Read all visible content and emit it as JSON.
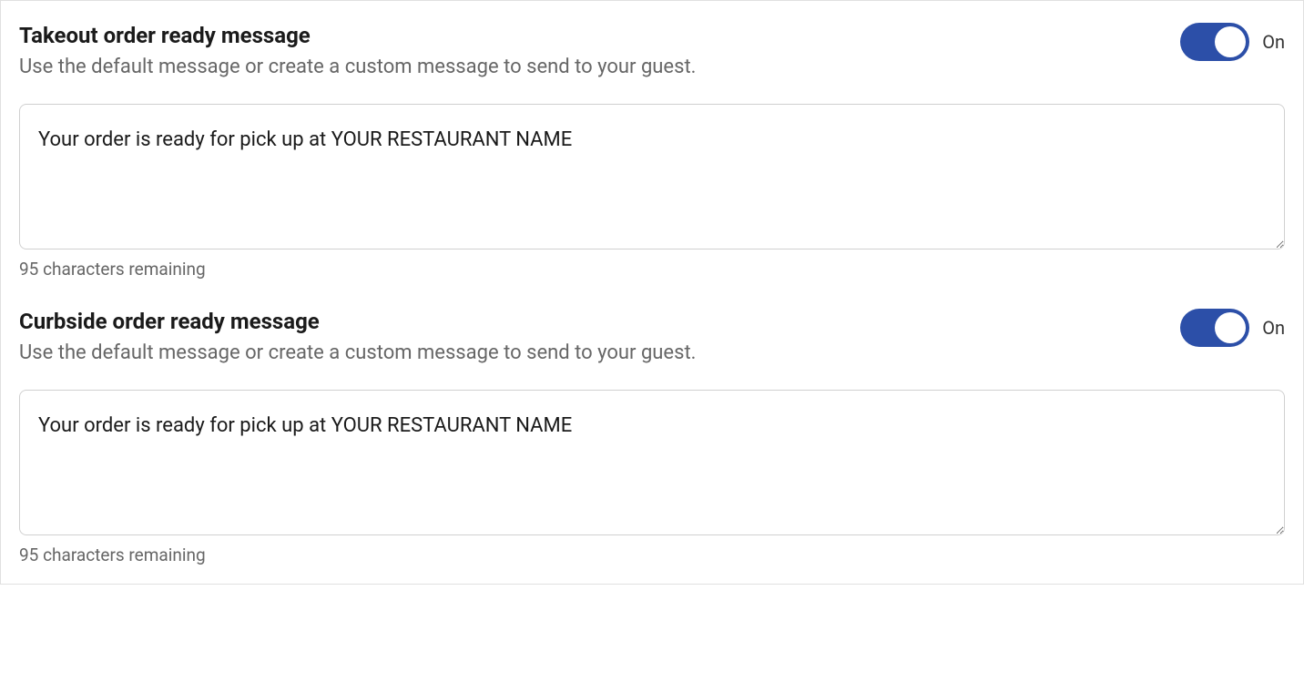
{
  "sections": [
    {
      "title": "Takeout order ready message",
      "description": "Use the default message or create a custom message to send to your guest.",
      "toggle_on": true,
      "toggle_label": "On",
      "message": "Your order is ready for pick up at YOUR RESTAURANT NAME",
      "char_remaining": "95 characters remaining"
    },
    {
      "title": "Curbside order ready message",
      "description": "Use the default message or create a custom message to send to your guest.",
      "toggle_on": true,
      "toggle_label": "On",
      "message": "Your order is ready for pick up at YOUR RESTAURANT NAME",
      "char_remaining": "95 characters remaining"
    }
  ]
}
